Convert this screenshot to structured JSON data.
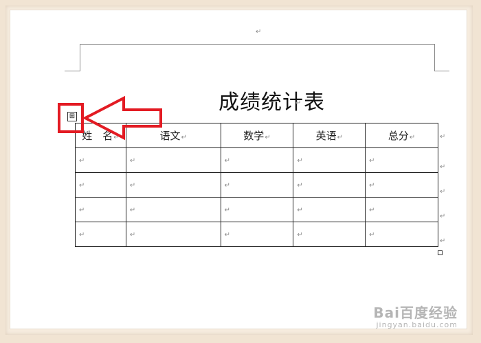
{
  "document": {
    "para_mark": "↵",
    "title": "成绩统计表",
    "table": {
      "headers": [
        "姓　名",
        "语文",
        "数学",
        "英语",
        "总分"
      ],
      "rows": [
        [
          "",
          "",
          "",
          "",
          ""
        ],
        [
          "",
          "",
          "",
          "",
          ""
        ],
        [
          "",
          "",
          "",
          "",
          ""
        ],
        [
          "",
          "",
          "",
          "",
          ""
        ]
      ]
    },
    "move_handle_glyph": "⊞"
  },
  "annotation": {
    "highlight_color": "#e31b23",
    "arrow_direction": "left"
  },
  "watermark": {
    "logo": "Bai百度经验",
    "url": "jingyan.baidu.com"
  }
}
